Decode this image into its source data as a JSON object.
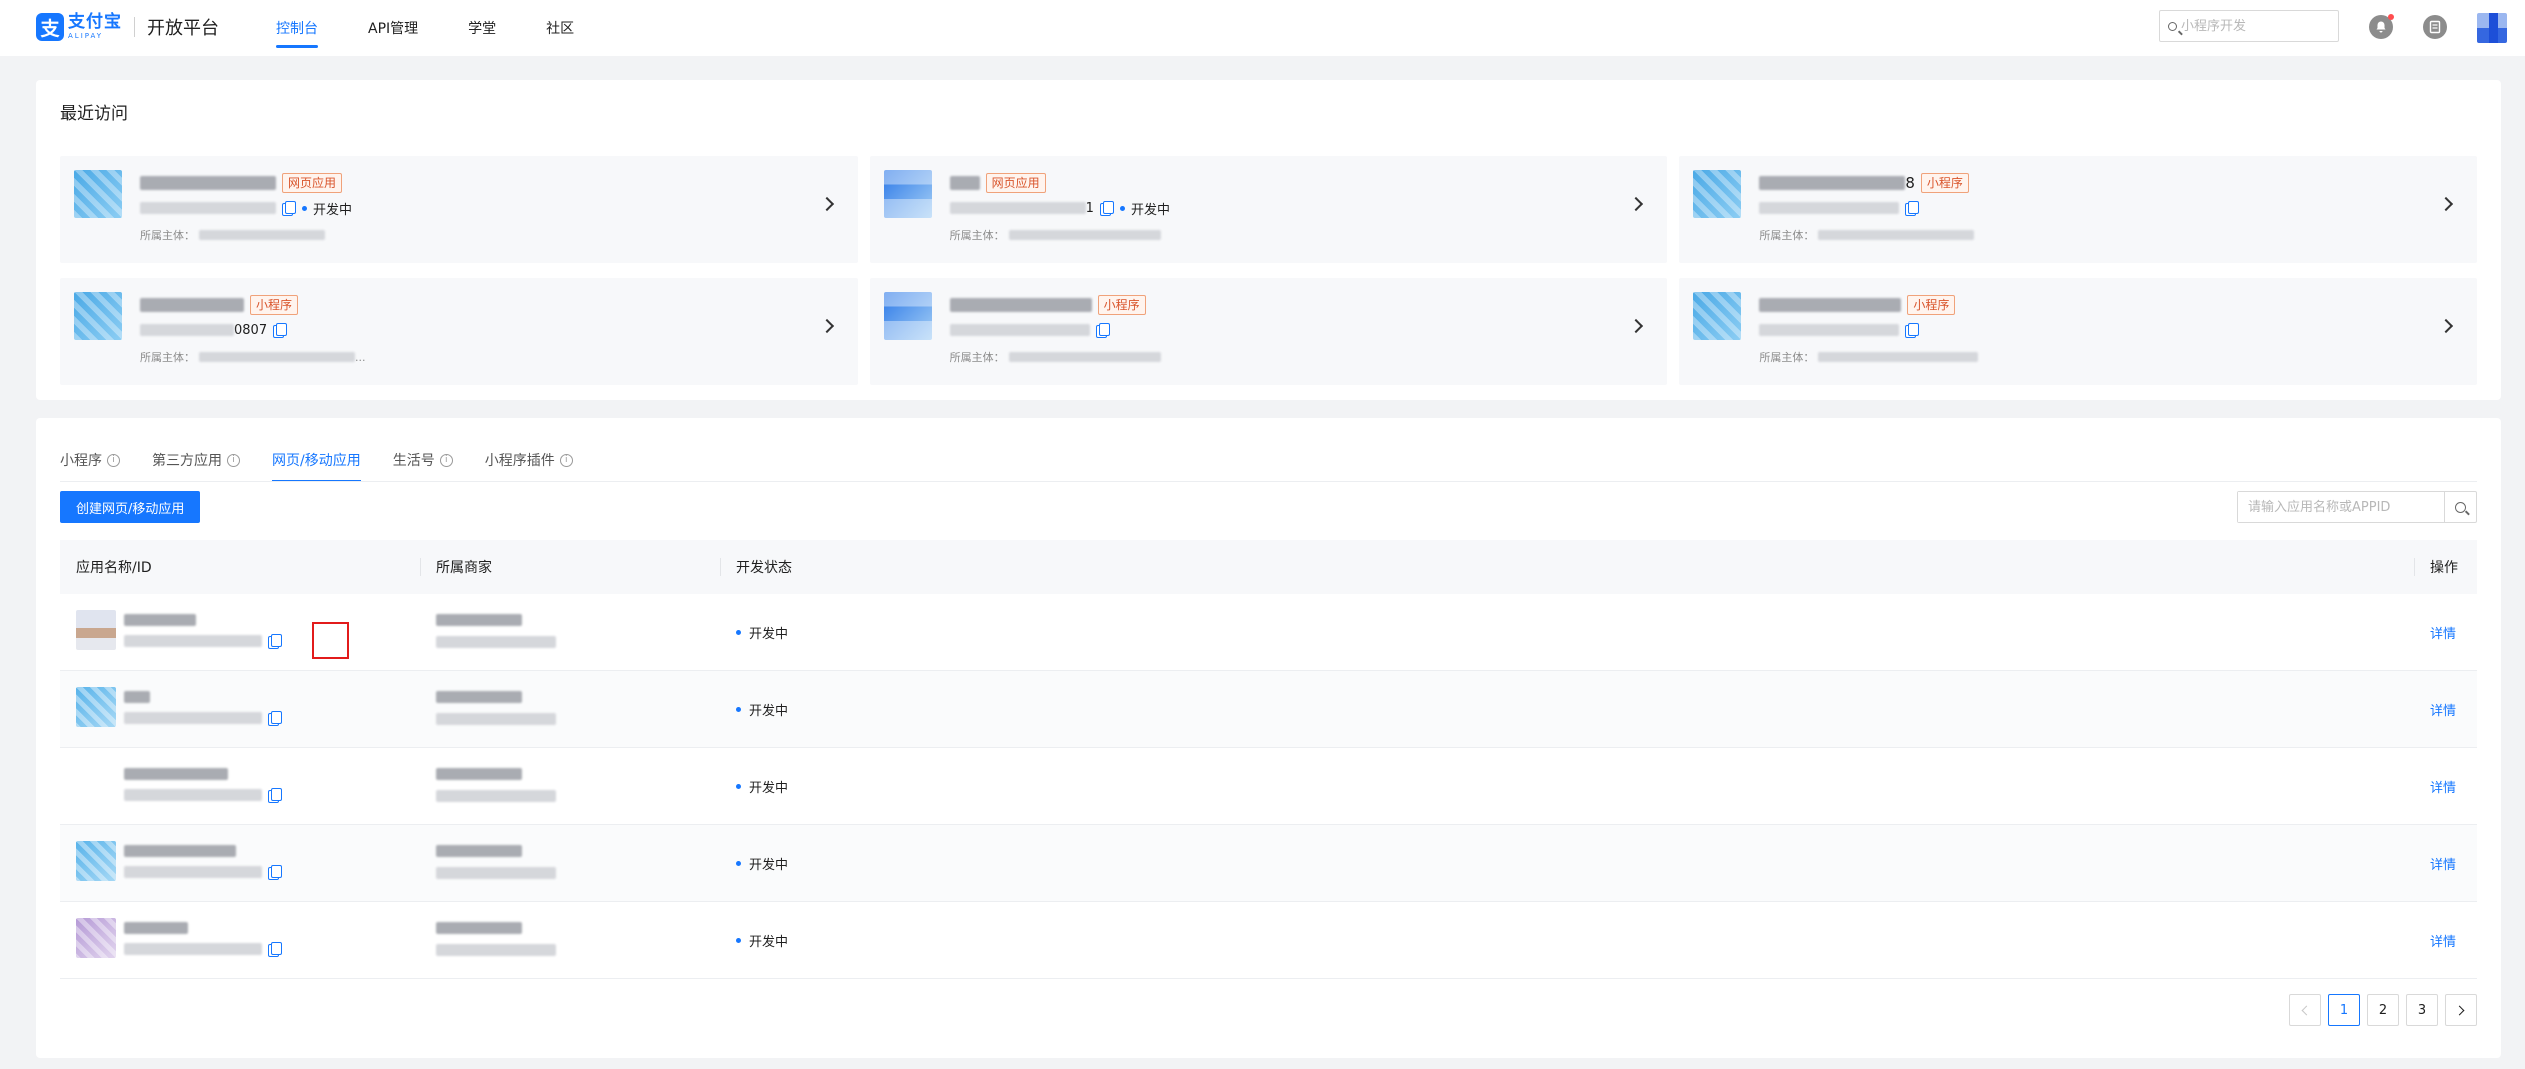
{
  "brand": {
    "logo_glyph": "支",
    "name_cn": "支付宝",
    "name_en": "ALIPAY",
    "platform": "开放平台"
  },
  "nav": [
    {
      "label": "控制台",
      "active": true
    },
    {
      "label": "API管理"
    },
    {
      "label": "学堂"
    },
    {
      "label": "社区"
    }
  ],
  "header_search": {
    "placeholder": "小程序开发"
  },
  "recent": {
    "title": "最近访问",
    "items": [
      {
        "tag": "网页应用",
        "id_suffix": "",
        "status": "开发中",
        "owner_label": "所属主体："
      },
      {
        "tag": "网页应用",
        "id_suffix": "1",
        "status": "开发中",
        "owner_label": "所属主体："
      },
      {
        "tag": "小程序",
        "name_suffix": "8",
        "id_suffix": "",
        "status": "",
        "owner_label": "所属主体："
      },
      {
        "tag": "小程序",
        "id_suffix": "0807",
        "status": "",
        "owner_label": "所属主体：",
        "owner_ellipsis": "..."
      },
      {
        "tag": "小程序",
        "id_suffix": "",
        "status": "",
        "owner_label": "所属主体："
      },
      {
        "tag": "小程序",
        "id_suffix": "",
        "status": "",
        "owner_label": "所属主体："
      }
    ]
  },
  "apps": {
    "tabs": [
      {
        "label": "小程序",
        "info": true
      },
      {
        "label": "第三方应用",
        "info": true
      },
      {
        "label": "网页/移动应用",
        "active": true
      },
      {
        "label": "生活号",
        "info": true
      },
      {
        "label": "小程序插件",
        "info": true
      }
    ],
    "info_glyph": "i",
    "create_button": "创建网页/移动应用",
    "search_placeholder": "请输入应用名称或APPID",
    "columns": {
      "name": "应用名称/ID",
      "merchant": "所属商家",
      "status": "开发状态",
      "action": "操作"
    },
    "rows": [
      {
        "status": "开发中",
        "action": "详情"
      },
      {
        "status": "开发中",
        "action": "详情"
      },
      {
        "status": "开发中",
        "action": "详情"
      },
      {
        "status": "开发中",
        "action": "详情"
      },
      {
        "status": "开发中",
        "action": "详情"
      }
    ],
    "pagination": {
      "pages": [
        "1",
        "2",
        "3"
      ],
      "current": "1"
    }
  },
  "colors": {
    "accent": "#1677ff",
    "tag": "#d9552c",
    "highlight": "#e21b1b"
  }
}
